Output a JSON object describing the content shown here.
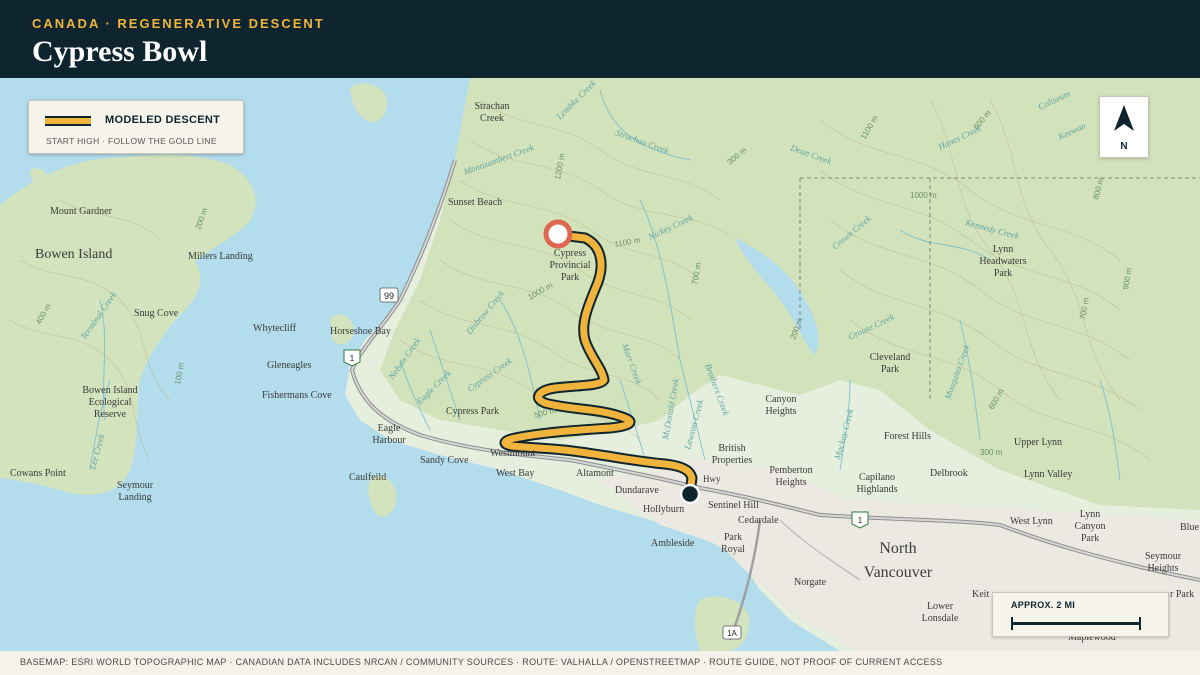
{
  "header": {
    "eyebrow": "CANADA · REGENERATIVE DESCENT",
    "title": "Cypress Bowl"
  },
  "legend": {
    "label": "MODELED DESCENT",
    "sub": "START HIGH · FOLLOW THE GOLD LINE"
  },
  "north_arrow": {
    "letter": "N",
    "icon": "north-arrow-icon"
  },
  "scale": {
    "label": "APPROX. 2 MI"
  },
  "footer": {
    "credits": "BASEMAP: ESRI WORLD TOPOGRAPHIC MAP · CANADIAN DATA INCLUDES NRCAN / COMMUNITY SOURCES · ROUTE: VALHALLA / OPENSTREETMAP · ROUTE GUIDE, NOT PROOF OF CURRENT ACCESS"
  },
  "colors": {
    "header_bg": "#0e2530",
    "accent_gold": "#f0b43c",
    "start_marker": "#e0674f",
    "end_marker": "#0e2530",
    "water": "#b3dced",
    "land": "#e8efe1",
    "forest": "#c9ddb0"
  },
  "map_labels": {
    "bowen_island": "Bowen Island",
    "mount_gardner": "Mount Gardner",
    "millers_landing": "Millers Landing",
    "snug_cove": "Snug Cove",
    "bowen_eco_1": "Bowen Island",
    "bowen_eco_2": "Ecological",
    "bowen_eco_3": "Reserve",
    "cowans_point": "Cowans Point",
    "seymour_landing_1": "Seymour",
    "seymour_landing_2": "Landing",
    "strachan_creek_1": "Strachan",
    "strachan_creek_2": "Creek",
    "sunset_beach": "Sunset Beach",
    "whytecliff": "Whytecliff",
    "horseshoe_bay": "Horseshoe Bay",
    "gleneagles": "Gleneagles",
    "fishermans_cove": "Fishermans Cove",
    "eagle_harbour_1": "Eagle",
    "eagle_harbour_2": "Harbour",
    "caulfeild": "Caulfeild",
    "sandy_cove": "Sandy Cove",
    "cypress_park": "Cypress Park",
    "westmount": "Westmount",
    "west_bay": "West Bay",
    "altamont": "Altamont",
    "dundarave": "Dundarave",
    "hollyburn": "Hollyburn",
    "ambleside": "Ambleside",
    "park_royal_1": "Park",
    "park_royal_2": "Royal",
    "sentinel_hill": "Sentinel Hill",
    "cedardale": "Cedardale",
    "british_props_1": "British",
    "british_props_2": "Properties",
    "pemberton_1": "Pemberton",
    "pemberton_2": "Heights",
    "canyon_heights_1": "Canyon",
    "canyon_heights_2": "Heights",
    "cypress_prov_1": "Cypress",
    "cypress_prov_2": "Provincial",
    "cypress_prov_3": "Park",
    "cleveland_1": "Cleveland",
    "cleveland_2": "Park",
    "forest_hills": "Forest Hills",
    "capilano_1": "Capilano",
    "capilano_2": "Highlands",
    "delbrook": "Delbrook",
    "upper_lynn": "Upper Lynn",
    "lynn_valley": "Lynn Valley",
    "west_lynn": "West Lynn",
    "lynn_canyon_1": "Lynn",
    "lynn_canyon_2": "Canyon",
    "lynn_canyon_3": "Park",
    "lynn_hw_1": "Lynn",
    "lynn_hw_2": "Headwaters",
    "lynn_hw_3": "Park",
    "north_van_1": "North",
    "north_van_2": "Vancouver",
    "norgate": "Norgate",
    "lower_lonsdale_1": "Lower",
    "lower_lonsdale_2": "Lonsdale",
    "seymour_heights_1": "Seymour",
    "seymour_heights_2": "Heights",
    "keith": "Keit",
    "maplewood": "Maplewood",
    "blue": "Blue",
    "seymour_park": "r Park",
    "hwy": "Hwy",
    "hwy_1a": "1A",
    "hwy_99": "99",
    "hwy_1": "1",
    "hwy_1b": "1",
    "hwy_1c": "1"
  },
  "water_labels": {
    "montizambert": "Montizambert Creek",
    "strachan_c": "Strachan Creek",
    "nickey": "Nickey Creek",
    "dean": "Dean Creek",
    "hanes": "Hanes Creek",
    "kennedy": "Kennedy Creek",
    "grouse": "Grouse Creek",
    "crown": "Crown Creek",
    "mosquito": "Mosquito Creek",
    "mackay": "Mackay Creek",
    "brothers": "Brothers Creek",
    "lawson": "Lawson Creek",
    "mcdonald": "McDonald Creek",
    "marr": "Marr Creek",
    "cypress_c": "Cypress Creek",
    "eagle_c": "Eagle Creek",
    "nelson": "Nelson Creek",
    "disbrow": "Disbrow Creek",
    "terminal": "Terminal Creek",
    "lee": "Lee Creek",
    "coliseum": "Coliseum",
    "lembke": "Lembke Creek",
    "keewan": "Keewan"
  },
  "contour_labels": {
    "c1": "1100 m",
    "c2": "1000 m",
    "c3": "1200 m",
    "c4": "1100 m",
    "c5": "700 m",
    "c6": "200 m",
    "c7": "500 m",
    "c8": "600 m",
    "c9": "300 m",
    "c10": "800 m",
    "c11": "1000 m",
    "c12": "900 m",
    "c13": "700 m",
    "c14": "600 m",
    "c15": "400 m",
    "c16": "200 m",
    "c17": "100 m",
    "c18": "300 m"
  }
}
